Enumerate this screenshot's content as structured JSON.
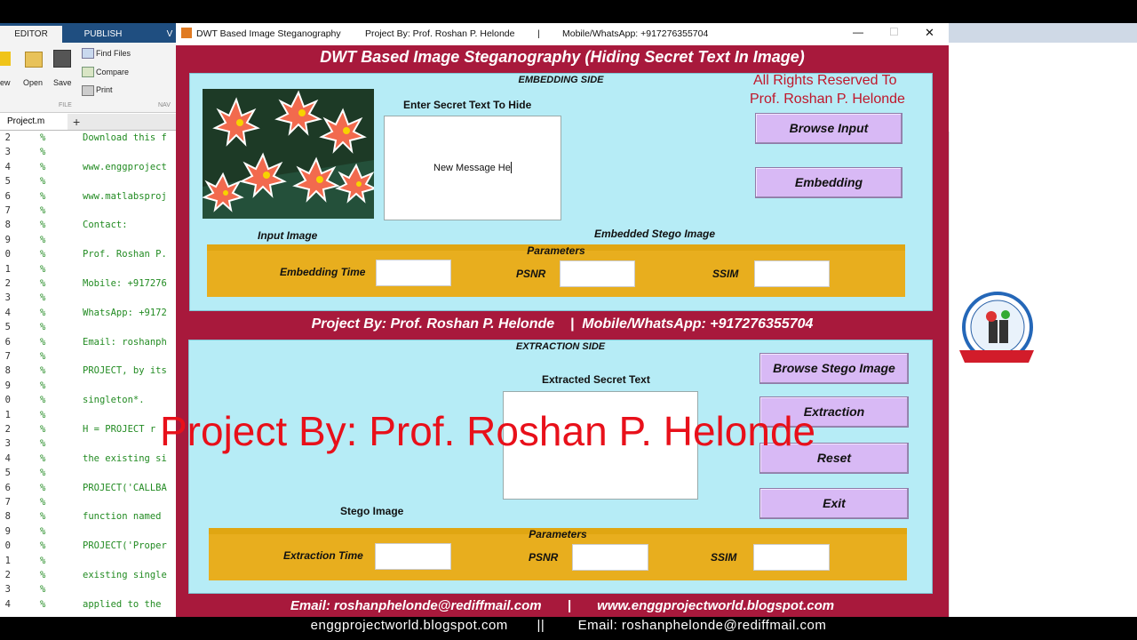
{
  "ribbon": {
    "tabs": [
      "EDITOR",
      "PUBLISH",
      "V"
    ],
    "buttons": {
      "new": "ew",
      "open": "Open",
      "save": "Save"
    },
    "find_files": "Find Files",
    "compare": "Compare",
    "print": "Print",
    "file_section": "FILE",
    "nav_section": "NAV"
  },
  "editor": {
    "file_tab": "Project.m",
    "line_numbers": [
      "2",
      "3",
      "4",
      "5",
      "6",
      "7",
      "8",
      "9",
      "0",
      "1",
      "2",
      "3",
      "4",
      "5",
      "6",
      "7",
      "8",
      "9",
      "0",
      "1",
      "2",
      "3",
      "4",
      "5",
      "6",
      "7",
      "8",
      "9",
      "0",
      "1",
      "2",
      "3",
      "4"
    ],
    "code_lines": [
      "Download this f",
      "",
      "www.enggproject",
      "",
      "www.matlabsproj",
      "",
      "Contact:",
      "",
      "Prof. Roshan P.",
      "",
      "Mobile: +917276",
      "",
      "WhatsApp: +9172",
      "",
      "Email: roshanph",
      "",
      "PROJECT, by its",
      "",
      "singleton*.",
      "",
      "H = PROJECT r",
      "",
      "the existing si",
      "",
      "PROJECT('CALLBA",
      "",
      "function named",
      "",
      "PROJECT('Proper",
      "",
      "existing single",
      "",
      "applied to the"
    ]
  },
  "window": {
    "title": "DWT Based Image Steganography",
    "project_by": "Project By: Prof. Roshan P. Helonde",
    "separator": "|",
    "mobile": "Mobile/WhatsApp: +917276355704",
    "minimize": "—",
    "maximize": "☐",
    "close": "✕"
  },
  "gui": {
    "heading": "DWT Based Image Steganography (Hiding Secret Text In Image)",
    "embedding": {
      "title": "EMBEDDING SIDE",
      "secret_label": "Enter Secret Text To Hide",
      "secret_value": "New Message He",
      "rights_line1": "All Rights Reserved To",
      "rights_line2": "Prof. Roshan P. Helonde",
      "browse_button": "Browse Input",
      "embed_button": "Embedding",
      "input_image_label": "Input Image",
      "stego_image_label": "Embedded Stego Image",
      "params_title": "Parameters",
      "time_label": "Embedding Time",
      "psnr_label": "PSNR",
      "ssim_label": "SSIM"
    },
    "middle_band": "Project By: Prof. Roshan P. Helonde    |  Mobile/WhatsApp: +917276355704",
    "extraction": {
      "title": "EXTRACTION SIDE",
      "extracted_label": "Extracted Secret Text",
      "browse_button": "Browse Stego Image",
      "extract_button": "Extraction",
      "reset_button": "Reset",
      "exit_button": "Exit",
      "stego_image_label": "Stego Image",
      "params_title": "Parameters",
      "time_label": "Extraction Time",
      "psnr_label": "PSNR",
      "ssim_label": "SSIM"
    },
    "bottom_band": "Email: roshanphelonde@rediffmail.com       |       www.enggprojectworld.blogspot.com"
  },
  "footer": "enggprojectworld.blogspot.com       ||        Email: roshanphelonde@rediffmail.com",
  "watermark": "Project By: Prof. Roshan P. Helonde",
  "colors": {
    "window_bg": "#a8193c",
    "panel_bg": "#b6ecf6",
    "button_bg": "#d8b9f5",
    "params_bg": "#e8ae1e",
    "rights_text": "#c0172b",
    "watermark": "#e8101a"
  }
}
